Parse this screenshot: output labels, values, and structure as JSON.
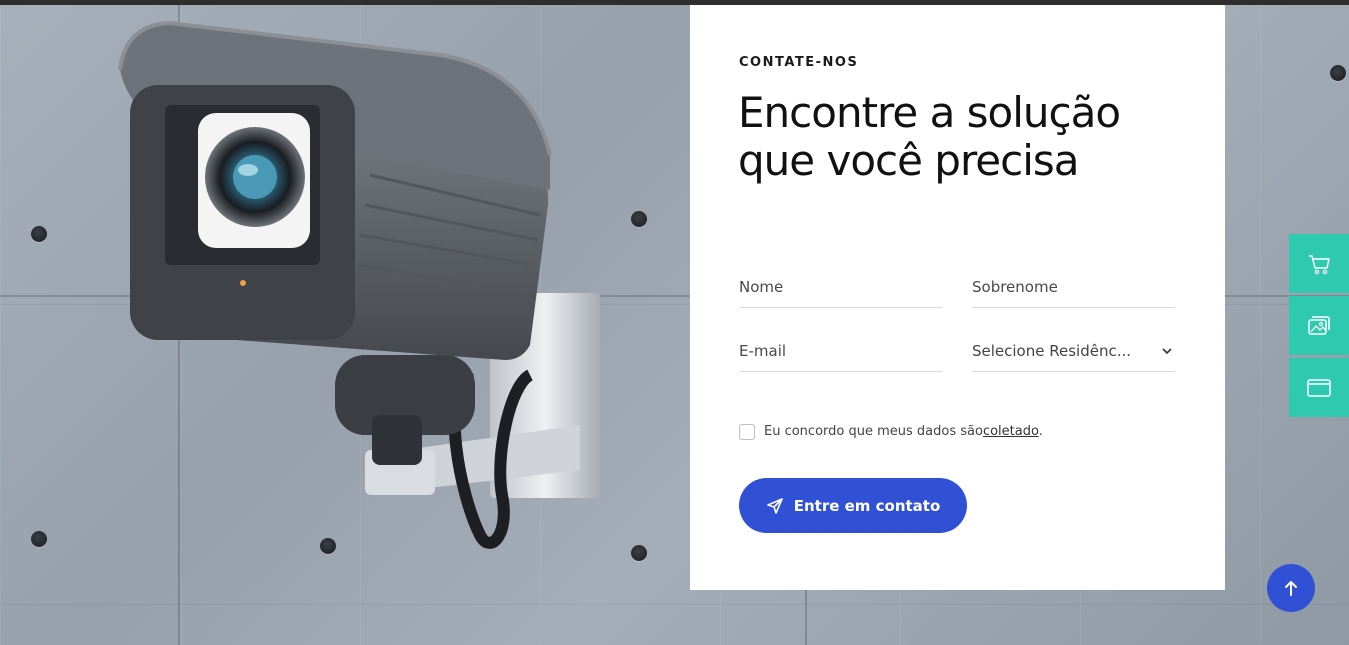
{
  "contact": {
    "eyebrow": "CONTATE-NOS",
    "heading": "Encontre a solução que você precisa",
    "fields": {
      "first_name_placeholder": "Nome",
      "last_name_placeholder": "Sobrenome",
      "email_placeholder": "E-mail",
      "residence_select_value": "Selecione Residênc..."
    },
    "consent": {
      "text": "Eu concordo que meus dados são",
      "link": "coletado",
      "suffix": "."
    },
    "submit_label": "Entre em contato"
  },
  "side_actions": {
    "icons": [
      "cart-icon",
      "gallery-icon",
      "browser-window-icon"
    ]
  },
  "colors": {
    "accent_blue": "#3050d6",
    "side_teal": "#2fc9b0"
  }
}
